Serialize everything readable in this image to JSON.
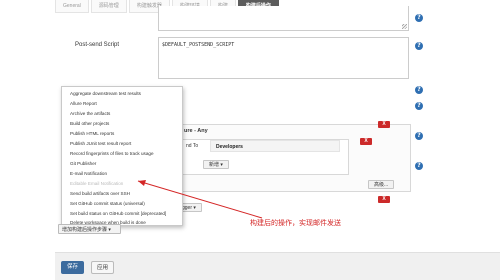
{
  "tabs": [
    "General",
    "源码管理",
    "构建触发器",
    "构建环境",
    "构建",
    "构建后操作"
  ],
  "post_send": {
    "label": "Post-send Script",
    "value": "$DEFAULT_POSTSEND_SCRIPT"
  },
  "email_panel": {
    "title_fragment": "ure - Any",
    "send_to_fragment": "nd To",
    "recipient": "Developers",
    "add_button": "新增 ▾",
    "advanced_button": "高级...",
    "trigger_button": "gger ▾",
    "delete_label": "X"
  },
  "post_build_menu": [
    "Aggregate downstream test results",
    "Allure Report",
    "Archive the artifacts",
    "Build other projects",
    "Publish HTML reports",
    "Publish JUnit test result report",
    "Record fingerprints of files to track usage",
    "Git Publisher",
    "E-mail Notification",
    "Editable Email Notification",
    "Send build artifacts over SSH",
    "Set GitHub commit status (universal)",
    "Set build status on GitHub commit [deprecated]",
    "Delete workspace when build is done"
  ],
  "add_step_button": "增加构建后操作步骤 ▾",
  "annotation": "构建后的操作，实现邮件发送",
  "footer": {
    "save": "保存",
    "apply": "应用"
  },
  "colors": {
    "active_tab": "#5c5c5c",
    "delete_button": "#cc2a2a",
    "help_icon": "#2f6fb2",
    "annotation": "#d42626",
    "save_button": "#3c6b9e"
  },
  "icons": [
    "help-icon",
    "delete-icon",
    "resize-grip-icon",
    "arrow-annotation"
  ]
}
